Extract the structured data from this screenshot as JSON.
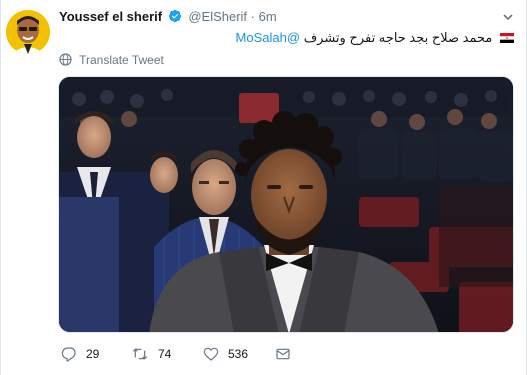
{
  "tweet": {
    "display_name": "Youssef el sherif",
    "handle": "@ElSherif",
    "separator": "·",
    "timestamp": "6m",
    "text_mention": "@MoSalah",
    "text_body": "محمد صلاح بجد حاجه تفرح وتشرف",
    "translate_label": "Translate Tweet"
  },
  "actions": {
    "replies": "29",
    "retweets": "74",
    "likes": "536"
  },
  "icons": {
    "avatar": "avatar",
    "verified": "verified-badge-icon",
    "caret": "chevron-down-icon",
    "flag": "egypt-flag-icon",
    "translate": "globe-icon",
    "reply": "reply-icon",
    "retweet": "retweet-icon",
    "like": "heart-icon",
    "dm": "envelope-icon"
  },
  "colors": {
    "link": "#1b95e0",
    "muted": "#657786",
    "text": "#14171a"
  }
}
